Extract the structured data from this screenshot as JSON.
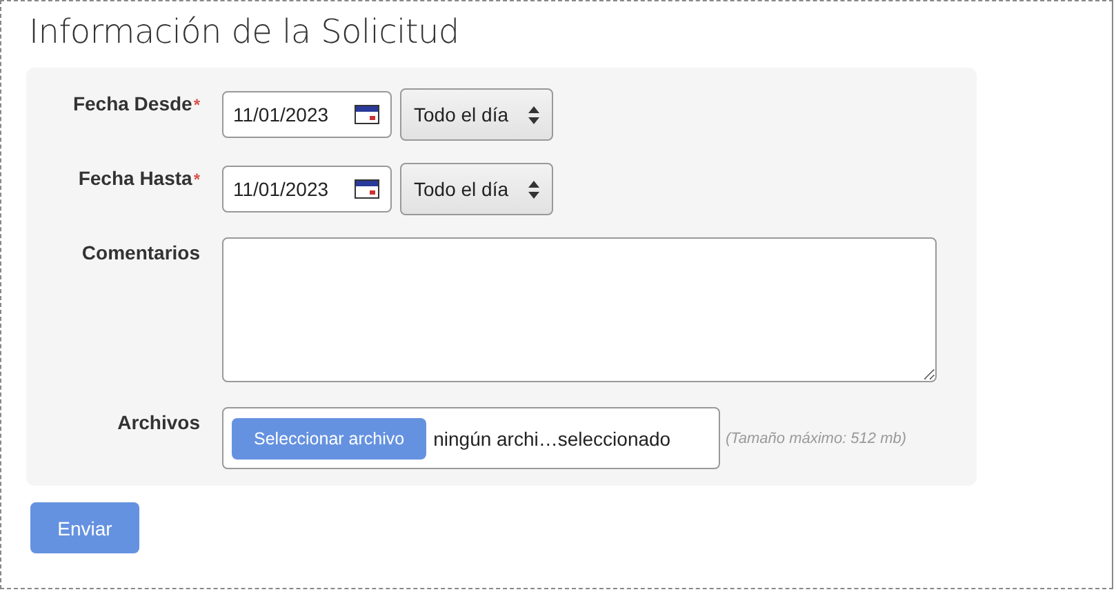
{
  "title": "Información de la Solicitud",
  "fields": [
    {
      "kind": "date",
      "label": "Fecha Desde",
      "required_mark": "*",
      "value": "11/01/2023",
      "period": "Todo el día"
    },
    {
      "kind": "date",
      "label": "Fecha Hasta",
      "required_mark": "*",
      "value": "11/01/2023",
      "period": "Todo el día"
    },
    {
      "kind": "textarea",
      "label": "Comentarios"
    },
    {
      "kind": "file",
      "label": "Archivos",
      "button": "Seleccionar archivo",
      "status": "ningún archi…seleccionado",
      "hint": "(Tamaño máximo: 512 mb)"
    }
  ],
  "submit": "Enviar"
}
